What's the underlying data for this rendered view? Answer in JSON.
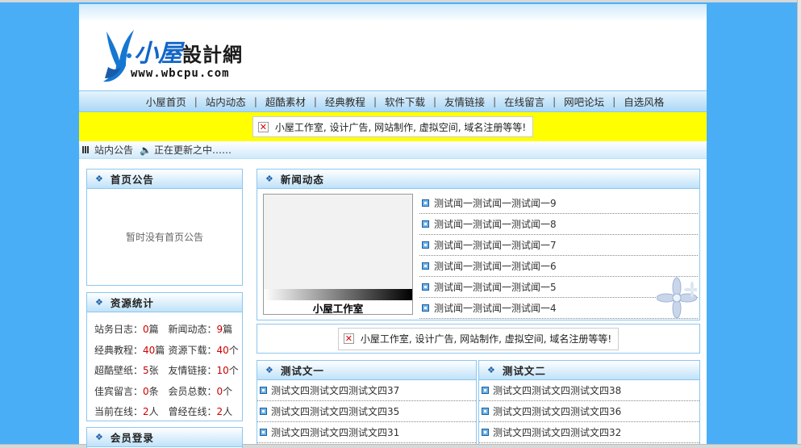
{
  "site": {
    "logo_cn": [
      "小",
      "屋",
      "設計網"
    ],
    "logo_url": "www.wbcpu.com"
  },
  "nav": {
    "items": [
      "小屋首页",
      "站内动态",
      "超酷素材",
      "经典教程",
      "软件下载",
      "友情链接",
      "在线留言",
      "网吧论坛",
      "自选风格"
    ]
  },
  "ad": {
    "text": "小屋工作室, 设计广告, 网站制作, 虚拟空间, 域名注册等等!"
  },
  "notice_bar": {
    "label": "站内公告",
    "text": "正在更新之中……"
  },
  "home_notice": {
    "title": "首页公告",
    "empty_text": "暂时没有首页公告"
  },
  "stats": {
    "title": "资源统计",
    "rows": [
      [
        {
          "label": "站务日志：",
          "value": "0",
          "unit": "篇"
        },
        {
          "label": "新闻动态：",
          "value": "9",
          "unit": "篇"
        }
      ],
      [
        {
          "label": "经典教程：",
          "value": "40",
          "unit": "篇"
        },
        {
          "label": "资源下载：",
          "value": "40",
          "unit": "个"
        }
      ],
      [
        {
          "label": "超酷壁纸：",
          "value": "5",
          "unit": "张"
        },
        {
          "label": "友情链接：",
          "value": "10",
          "unit": "个"
        }
      ],
      [
        {
          "label": "佳宾留言：",
          "value": "0",
          "unit": "条"
        },
        {
          "label": "会员总数：",
          "value": "0",
          "unit": "个"
        }
      ],
      [
        {
          "label": "当前在线：",
          "value": "2",
          "unit": "人"
        },
        {
          "label": "曾经在线：",
          "value": "2",
          "unit": "人"
        }
      ]
    ]
  },
  "login": {
    "title": "会员登录"
  },
  "news": {
    "title": "新闻动态",
    "image_caption": "小屋工作室",
    "items": [
      "测试闻一测试闻一测试闻一9",
      "测试闻一测试闻一测试闻一8",
      "测试闻一测试闻一测试闻一7",
      "测试闻一测试闻一测试闻一6",
      "测试闻一测试闻一测试闻一5",
      "测试闻一测试闻一测试闻一4"
    ]
  },
  "col1": {
    "title": "测试文一",
    "items": [
      "测试文四测试文四测试文四37",
      "测试文四测试文四测试文四35",
      "测试文四测试文四测试文四31"
    ]
  },
  "col2": {
    "title": "测试文二",
    "items": [
      "测试文四测试文四测试文四38",
      "测试文四测试文四测试文四36",
      "测试文四测试文四测试文四32"
    ]
  }
}
